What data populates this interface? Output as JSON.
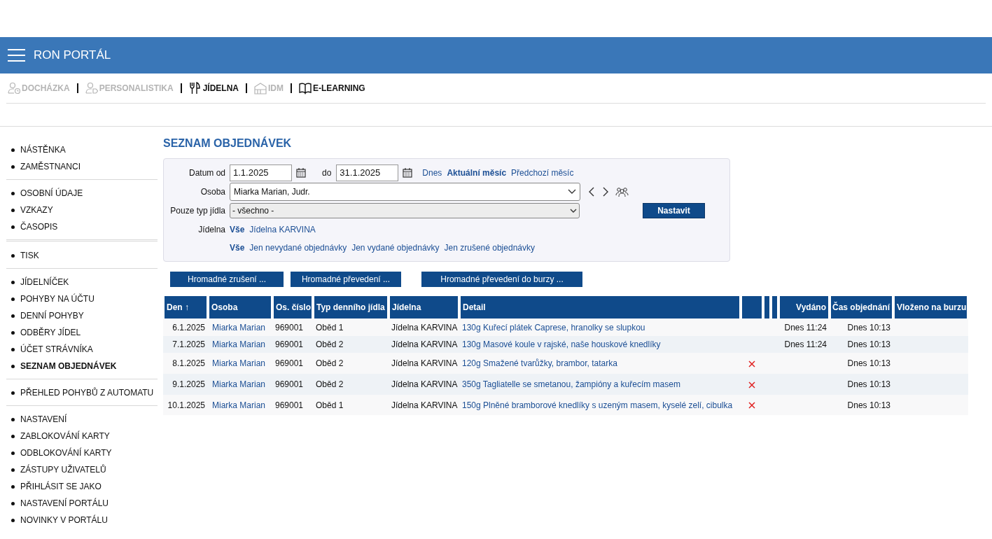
{
  "header": {
    "title": "RON PORTÁL"
  },
  "modules": [
    {
      "label": "DOCHÁZKA",
      "disabled": true
    },
    {
      "label": "PERSONALISTIKA",
      "disabled": true
    },
    {
      "label": "JÍDELNA",
      "disabled": false
    },
    {
      "label": "IDM",
      "disabled": true
    },
    {
      "label": "E-LEARNING",
      "disabled": false
    }
  ],
  "sidebar": {
    "groups": [
      {
        "kind": "plain",
        "items": [
          {
            "label": "NÁSTĚNKA",
            "selected": false
          },
          {
            "label": "ZAMĚSTNANCI",
            "selected": false
          }
        ]
      },
      {
        "kind": "plain",
        "items": [
          {
            "label": "OSOBNÍ ÚDAJE",
            "selected": false
          },
          {
            "label": "VZKAZY",
            "selected": false
          },
          {
            "label": "ČASOPIS",
            "selected": false
          }
        ]
      },
      {
        "kind": "separated",
        "items": [
          {
            "label": "TISK",
            "selected": false
          }
        ]
      },
      {
        "kind": "plain",
        "items": [
          {
            "label": "JÍDELNÍČEK",
            "selected": false
          },
          {
            "label": "POHYBY NA ÚČTU",
            "selected": false
          },
          {
            "label": "DENNÍ POHYBY",
            "selected": false
          },
          {
            "label": "ODBĚRY JÍDEL",
            "selected": false
          },
          {
            "label": "ÚČET STRÁVNÍKA",
            "selected": false
          },
          {
            "label": "SEZNAM OBJEDNÁVEK",
            "selected": true
          }
        ]
      },
      {
        "kind": "plain",
        "items": [
          {
            "label": "PŘEHLED POHYBŮ Z AUTOMATU",
            "selected": false
          }
        ]
      },
      {
        "kind": "plain",
        "items": [
          {
            "label": "NASTAVENÍ",
            "selected": false
          },
          {
            "label": "ZABLOKOVÁNÍ KARTY",
            "selected": false
          },
          {
            "label": "ODBLOKOVÁNÍ KARTY",
            "selected": false
          },
          {
            "label": "ZÁSTUPY UŽIVATELŮ",
            "selected": false
          },
          {
            "label": "PŘIHLÁSIT SE JAKO",
            "selected": false
          },
          {
            "label": "NASTAVENÍ PORTÁLU",
            "selected": false
          },
          {
            "label": "NOVINKY V PORTÁLU",
            "selected": false
          }
        ]
      }
    ]
  },
  "page_title": "SEZNAM OBJEDNÁVEK",
  "filter": {
    "date_from": {
      "label": "Datum od",
      "value": "1.1.2025"
    },
    "date_to": {
      "label": "do",
      "value": "31.1.2025"
    },
    "period_links": [
      {
        "label": "Dnes",
        "selected": false
      },
      {
        "label": "Aktuální měsíc",
        "selected": true
      },
      {
        "label": "Předchozí měsíc",
        "selected": false
      }
    ],
    "person": {
      "label": "Osoba",
      "value": "Miarka Marian, Judr."
    },
    "meal_type": {
      "label": "Pouze typ jídla",
      "value": "- všechno -"
    },
    "apply_button": "Nastavit",
    "canteen": {
      "label": "Jídelna",
      "options": [
        {
          "label": "Vše",
          "selected": true
        },
        {
          "label": "Jídelna KARVINA",
          "selected": false
        }
      ]
    },
    "status_options": [
      {
        "label": "Vše",
        "selected": true
      },
      {
        "label": "Jen nevydané objednávky",
        "selected": false
      },
      {
        "label": "Jen vydané objednávky",
        "selected": false
      },
      {
        "label": "Jen zrušené objednávky",
        "selected": false
      }
    ]
  },
  "actions": [
    "Hromadné zrušení ...",
    "Hromadné převedení ...",
    "Hromadné převedení do burzy ..."
  ],
  "table": {
    "columns": [
      {
        "label": "Den ↑"
      },
      {
        "label": "Osoba"
      },
      {
        "label": "Os. číslo"
      },
      {
        "label": "Typ denního jídla"
      },
      {
        "label": "Jídelna"
      },
      {
        "label": "Detail"
      },
      {},
      {},
      {},
      {
        "label": "Vydáno"
      },
      {
        "label": "Čas objednání"
      },
      {
        "label": "Vloženo na burzu"
      }
    ],
    "rows": [
      {
        "day": "6.1.2025",
        "person": "Miarka Marian",
        "number": "969001",
        "meal": "Oběd 1",
        "canteen": "Jídelna KARVINA",
        "detail": "130g Kuřecí plátek Caprese, hranolky se slupkou",
        "cancelled": false,
        "issued": "Dnes 11:24",
        "ordered": "Dnes 10:13"
      },
      {
        "day": "7.1.2025",
        "person": "Miarka Marian",
        "number": "969001",
        "meal": "Oběd 2",
        "canteen": "Jídelna KARVINA",
        "detail": "130g Masové koule v rajské, naše houskové knedlíky",
        "cancelled": false,
        "issued": "Dnes 11:24",
        "ordered": "Dnes 10:13"
      },
      {
        "day": "8.1.2025",
        "person": "Miarka Marian",
        "number": "969001",
        "meal": "Oběd 2",
        "canteen": "Jídelna KARVINA",
        "detail": "120g Smažené tvarůžky, brambor, tatarka",
        "cancelled": true,
        "ordered": "Dnes 10:13"
      },
      {
        "day": "9.1.2025",
        "person": "Miarka Marian",
        "number": "969001",
        "meal": "Oběd 2",
        "canteen": "Jídelna KARVINA",
        "detail": "350g Tagliatelle se smetanou, žampióny a kuřecím masem",
        "cancelled": true,
        "ordered": "Dnes 10:13"
      },
      {
        "day": "10.1.2025",
        "person": "Miarka Marian",
        "number": "969001",
        "meal": "Oběd 1",
        "canteen": "Jídelna KARVINA",
        "detail": "150g Plněné bramborové knedlíky s uzeným masem, kyselé zelí, cibulka",
        "cancelled": true,
        "ordered": "Dnes 10:13"
      }
    ]
  }
}
